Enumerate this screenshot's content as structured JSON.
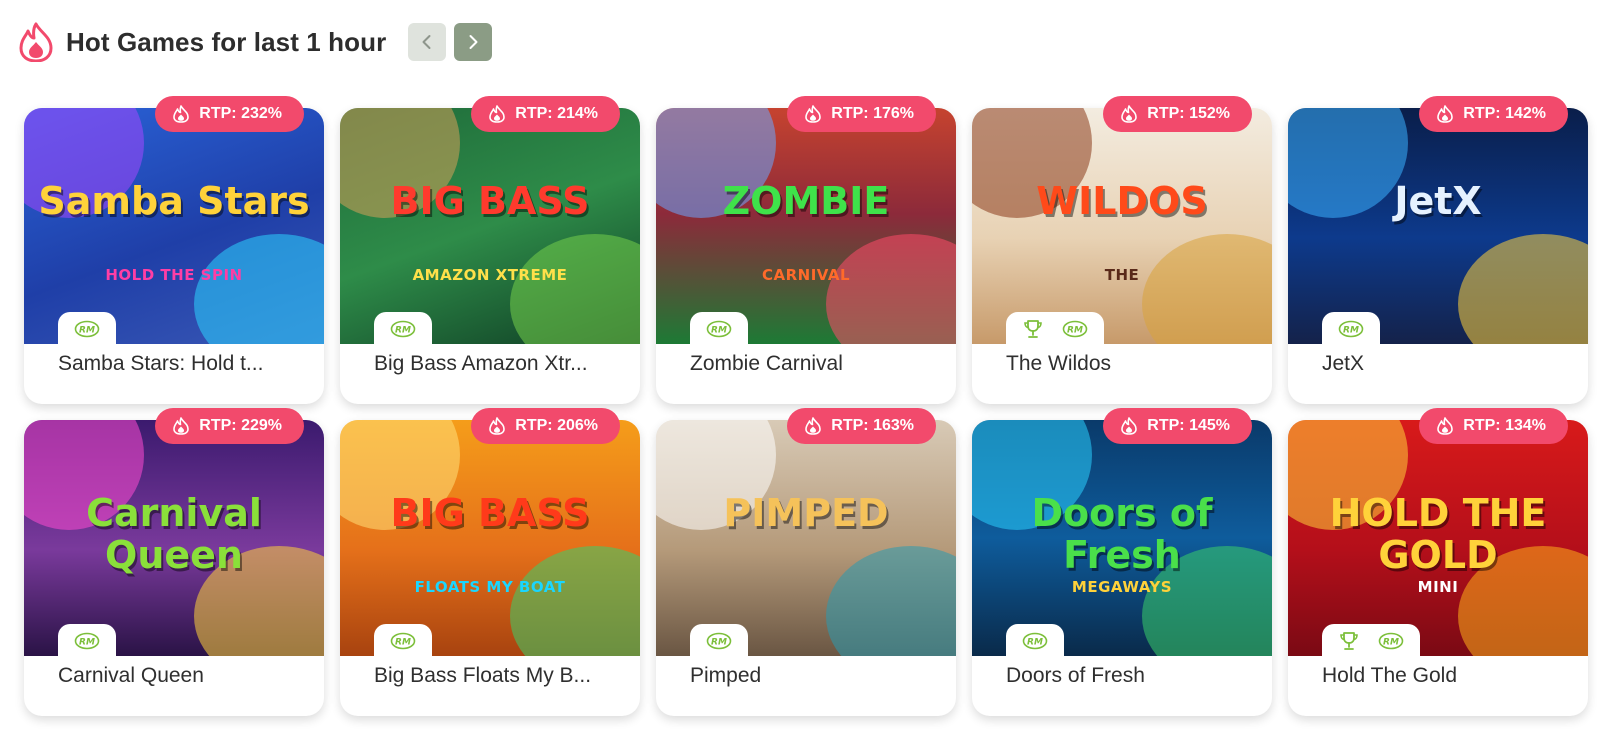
{
  "header": {
    "title": "Hot Games for last 1 hour",
    "brand_color": "#f24a6c"
  },
  "games": [
    {
      "name": "Samba Stars: Hold t...",
      "rtp": "RTP: 232%",
      "art_title": "Samba Stars",
      "art_sub": "HOLD THE SPIN",
      "trophy": false
    },
    {
      "name": "Big Bass Amazon Xtr...",
      "rtp": "RTP: 214%",
      "art_title": "BIG BASS",
      "art_sub": "AMAZON XTREME",
      "trophy": false
    },
    {
      "name": "Zombie Carnival",
      "rtp": "RTP: 176%",
      "art_title": "ZOMBIE",
      "art_sub": "CARNIVAL",
      "trophy": false
    },
    {
      "name": "The Wildos",
      "rtp": "RTP: 152%",
      "art_title": "WILDOS",
      "art_sub": "THE",
      "trophy": true
    },
    {
      "name": "JetX",
      "rtp": "RTP: 142%",
      "art_title": "JetX",
      "art_sub": "",
      "trophy": false
    },
    {
      "name": "Carnival Queen",
      "rtp": "RTP: 229%",
      "art_title": "Carnival Queen",
      "art_sub": "",
      "trophy": false
    },
    {
      "name": "Big Bass Floats My B...",
      "rtp": "RTP: 206%",
      "art_title": "BIG BASS",
      "art_sub": "FLOATS MY BOAT",
      "trophy": false
    },
    {
      "name": "Pimped",
      "rtp": "RTP: 163%",
      "art_title": "PIMPED",
      "art_sub": "",
      "trophy": false
    },
    {
      "name": "Doors of Fresh",
      "rtp": "RTP: 145%",
      "art_title": "Doors of Fresh",
      "art_sub": "MEGAWAYS",
      "trophy": false
    },
    {
      "name": "Hold The Gold",
      "rtp": "RTP: 134%",
      "art_title": "HOLD THE GOLD",
      "art_sub": "MINI",
      "trophy": true
    }
  ]
}
